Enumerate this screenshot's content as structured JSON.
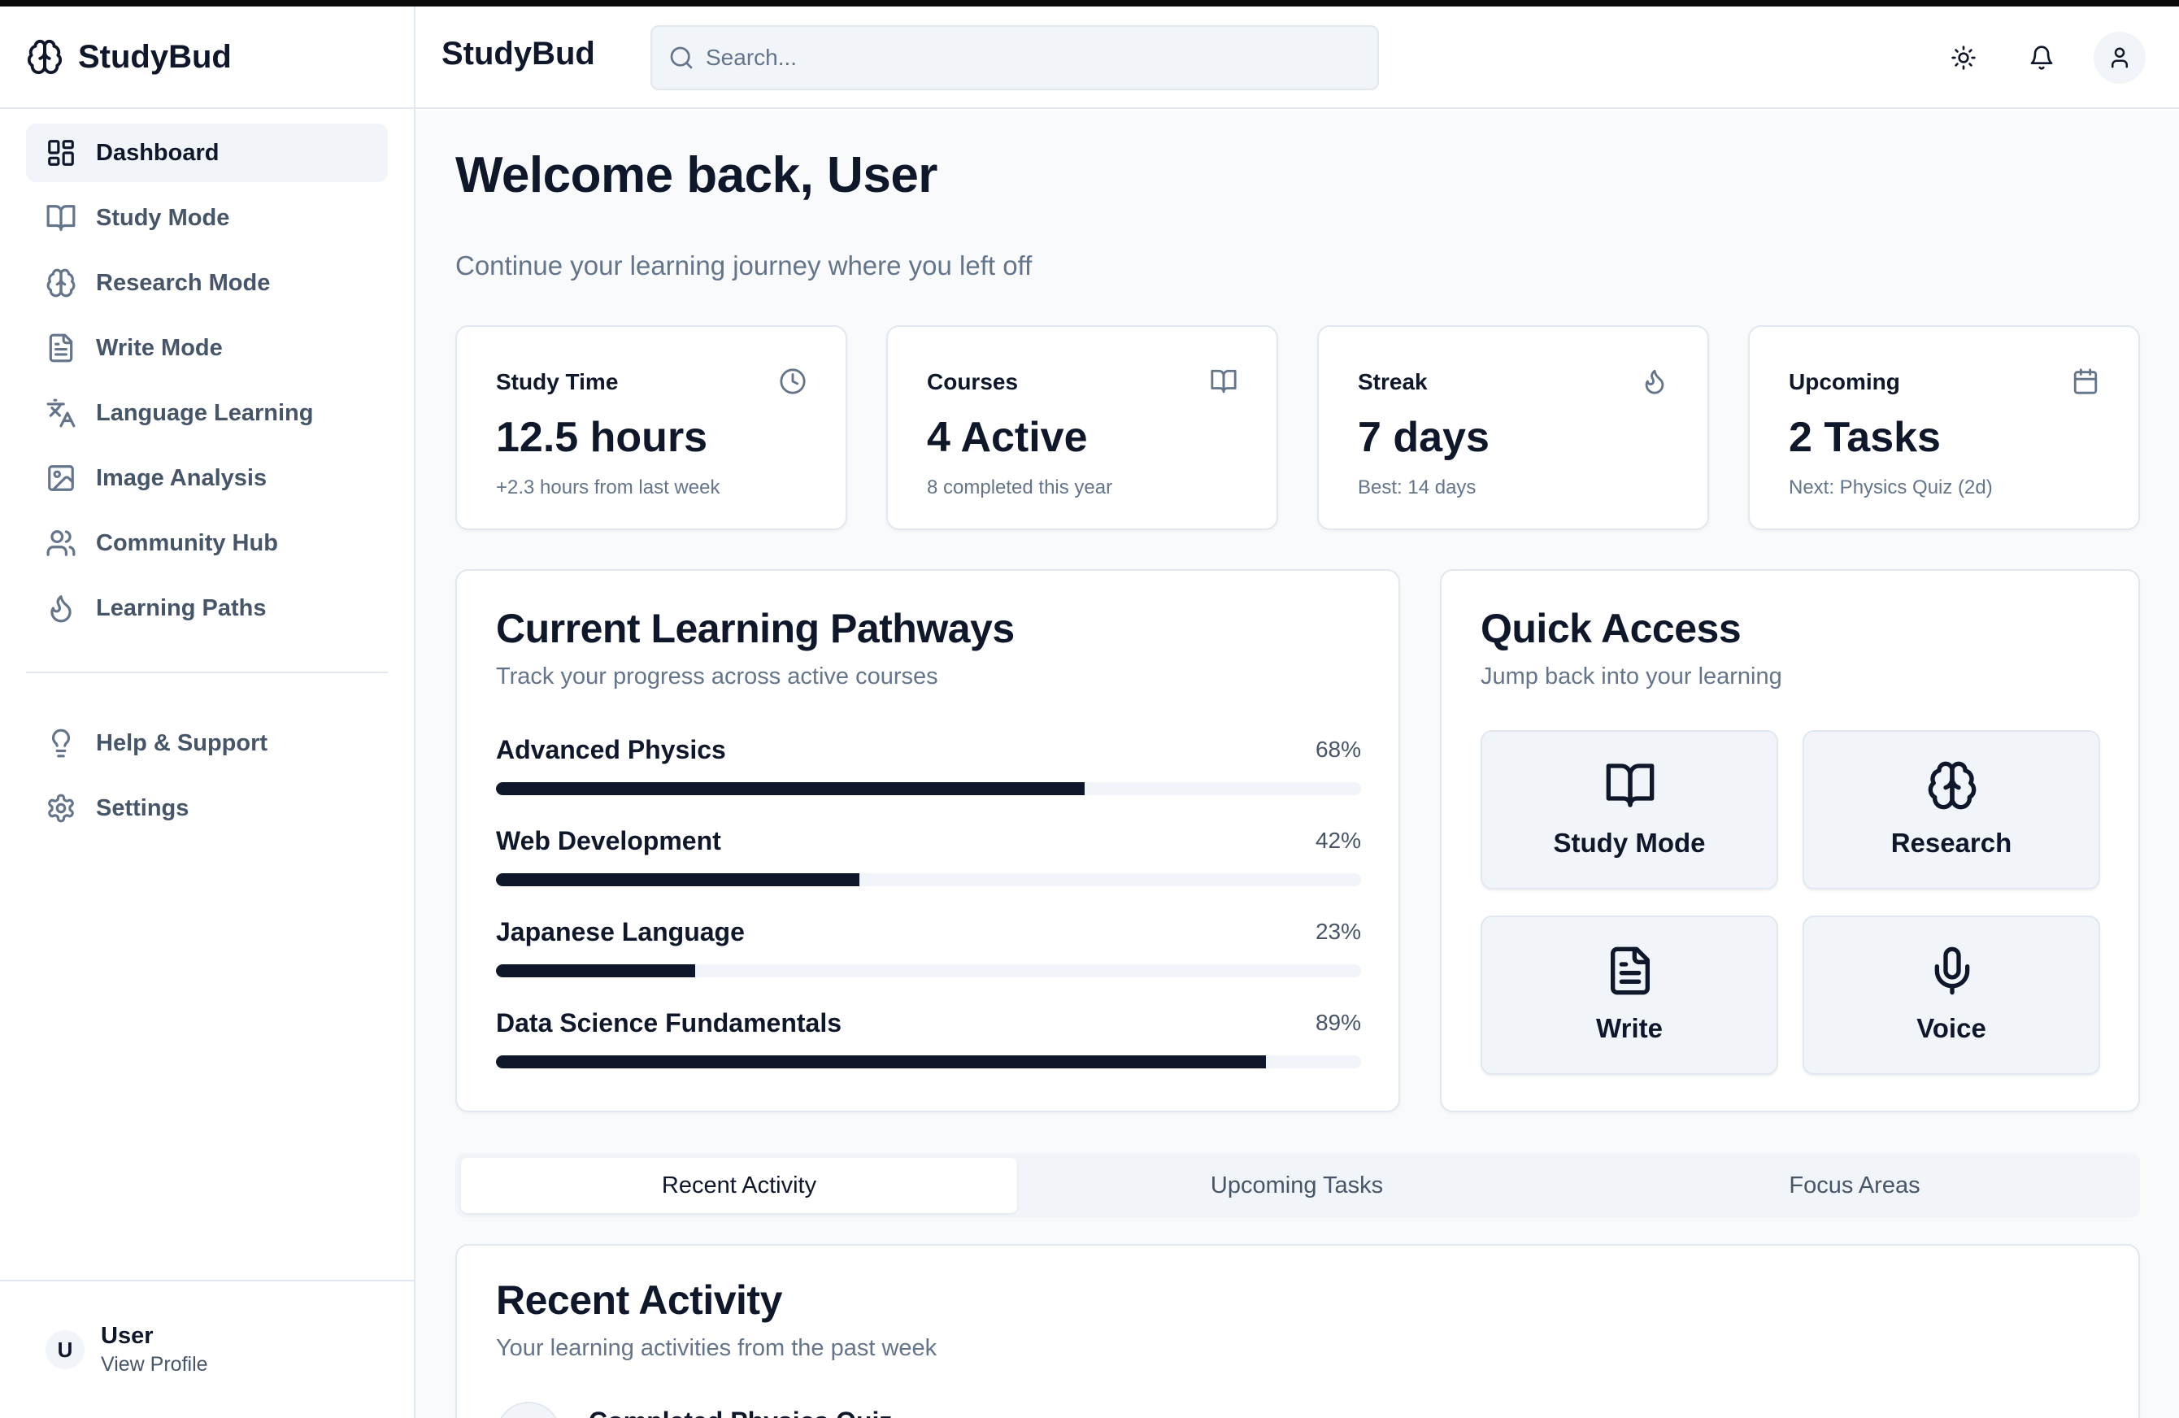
{
  "app": {
    "name": "StudyBud"
  },
  "sidebar": {
    "brand": "StudyBud",
    "items": [
      {
        "label": "Dashboard",
        "icon": "dashboard-icon",
        "active": true
      },
      {
        "label": "Study Mode",
        "icon": "book-icon"
      },
      {
        "label": "Research Mode",
        "icon": "brain-icon"
      },
      {
        "label": "Write Mode",
        "icon": "file-text-icon"
      },
      {
        "label": "Language Learning",
        "icon": "languages-icon"
      },
      {
        "label": "Image Analysis",
        "icon": "image-icon"
      },
      {
        "label": "Community Hub",
        "icon": "users-icon"
      },
      {
        "label": "Learning Paths",
        "icon": "flame-icon"
      }
    ],
    "secondary": [
      {
        "label": "Help & Support",
        "icon": "lightbulb-icon"
      },
      {
        "label": "Settings",
        "icon": "gear-icon"
      }
    ],
    "user": {
      "initial": "U",
      "name": "User",
      "link": "View Profile"
    }
  },
  "topbar": {
    "title": "StudyBud",
    "search_placeholder": "Search...",
    "icons": [
      "sun-icon",
      "bell-icon",
      "user-icon"
    ]
  },
  "main": {
    "welcome": "Welcome back, User",
    "subtitle": "Continue your learning journey where you left off",
    "stats": [
      {
        "label": "Study Time",
        "value": "12.5 hours",
        "sub": "+2.3 hours from last week",
        "icon": "clock-icon"
      },
      {
        "label": "Courses",
        "value": "4 Active",
        "sub": "8 completed this year",
        "icon": "book-icon"
      },
      {
        "label": "Streak",
        "value": "7 days",
        "sub": "Best: 14 days",
        "icon": "flame-icon"
      },
      {
        "label": "Upcoming",
        "value": "2 Tasks",
        "sub": "Next: Physics Quiz (2d)",
        "icon": "calendar-icon"
      }
    ],
    "pathways": {
      "title": "Current Learning Pathways",
      "subtitle": "Track your progress across active courses",
      "courses": [
        {
          "name": "Advanced Physics",
          "percent_label": "68%",
          "progress": 0.68
        },
        {
          "name": "Web Development",
          "percent_label": "42%",
          "progress": 0.42
        },
        {
          "name": "Japanese Language",
          "percent_label": "23%",
          "progress": 0.23
        },
        {
          "name": "Data Science Fundamentals",
          "percent_label": "89%",
          "progress": 0.89
        }
      ]
    },
    "quick_access": {
      "title": "Quick Access",
      "subtitle": "Jump back into your learning",
      "tiles": [
        {
          "label": "Study Mode",
          "icon": "book-open-icon"
        },
        {
          "label": "Research",
          "icon": "brain-icon"
        },
        {
          "label": "Write",
          "icon": "file-text-icon"
        },
        {
          "label": "Voice",
          "icon": "microphone-icon"
        }
      ]
    },
    "tabs": [
      {
        "label": "Recent Activity",
        "active": true
      },
      {
        "label": "Upcoming Tasks"
      },
      {
        "label": "Focus Areas"
      }
    ],
    "recent": {
      "title": "Recent Activity",
      "subtitle": "Your learning activities from the past week",
      "first_item": "Completed Physics Quiz"
    }
  },
  "colors": {
    "primary": "#0f172a",
    "muted": "#64748b",
    "border": "#e2e8f0",
    "surface": "#f1f5f9",
    "background": "#f8fafc"
  }
}
